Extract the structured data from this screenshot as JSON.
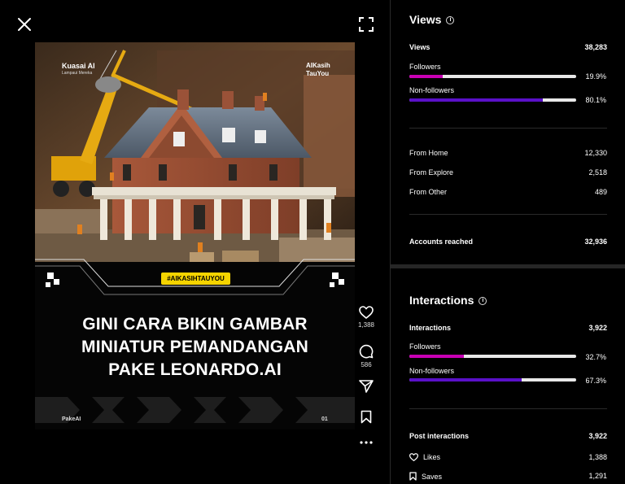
{
  "post": {
    "brand_left": "Kuasai AI",
    "brand_left_sub": "Lampaui Mereka",
    "brand_right_line1": "AIKasih",
    "brand_right_line2": "TauYou",
    "hashtag": "#AIKASIHTAUYOU",
    "headline_lines": [
      "GINI CARA BIKIN GAMBAR",
      "MINIATUR PEMANDANGAN",
      "PAKE LEONARDO.AI"
    ],
    "footer_left": "PakeAI",
    "footer_right": "01"
  },
  "actions": {
    "likes": "1,388",
    "comments": "586"
  },
  "views": {
    "title": "Views",
    "total_label": "Views",
    "total_value": "38,283",
    "followers_label": "Followers",
    "followers_pct": "19.9%",
    "followers_fraction": 0.199,
    "nonfollowers_label": "Non-followers",
    "nonfollowers_pct": "80.1%",
    "nonfollowers_fraction": 0.801,
    "sources": [
      {
        "label": "From Home",
        "value": "12,330"
      },
      {
        "label": "From Explore",
        "value": "2,518"
      },
      {
        "label": "From Other",
        "value": "489"
      }
    ],
    "reached_label": "Accounts reached",
    "reached_value": "32,936"
  },
  "interactions": {
    "title": "Interactions",
    "total_label": "Interactions",
    "total_value": "3,922",
    "followers_label": "Followers",
    "followers_pct": "32.7%",
    "followers_fraction": 0.327,
    "nonfollowers_label": "Non-followers",
    "nonfollowers_pct": "67.3%",
    "nonfollowers_fraction": 0.673,
    "post_label": "Post interactions",
    "post_value": "3,922",
    "likes_label": "Likes",
    "likes_value": "1,388",
    "saves_label": "Saves",
    "saves_value": "1,291"
  },
  "colors": {
    "followers_bar": "#c800b4",
    "nonfollowers_bar": "#5a10c8",
    "hashtag_bg": "#f5d400"
  }
}
